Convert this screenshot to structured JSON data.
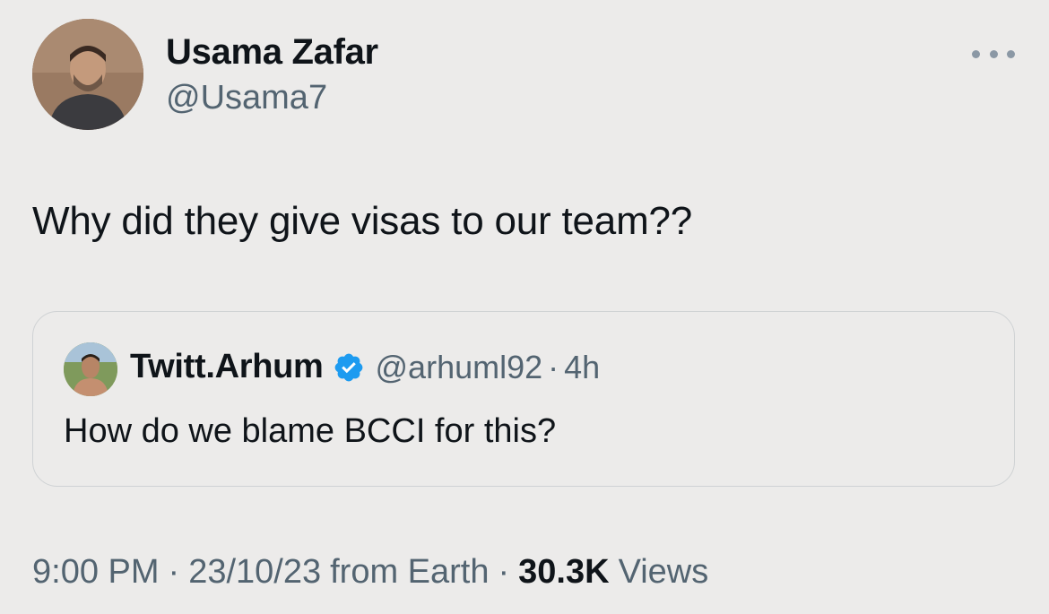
{
  "tweet": {
    "author": {
      "name": "Usama Zafar",
      "handle": "@Usama7"
    },
    "text": "Why did they give visas to our team??",
    "quoted": {
      "name": "Twitt.Arhum",
      "handle": "@arhuml92",
      "dot": "·",
      "time": "4h",
      "verified": true,
      "verified_color": "#1d9bf0",
      "text": "How do we blame BCCI for this?"
    },
    "meta": {
      "time": "9:00 PM",
      "sep1": "·",
      "date": "23/10/23",
      "source": "from Earth",
      "sep2": "·",
      "views_count": "30.3K",
      "views_label": "Views"
    }
  },
  "icons": {
    "more": "more-horizontal-icon",
    "verified": "verified-badge-icon"
  },
  "colors": {
    "background": "#ecebea",
    "text_primary": "#0f1419",
    "text_secondary": "#536471",
    "border": "#cfd2d4",
    "accent": "#1d9bf0"
  }
}
